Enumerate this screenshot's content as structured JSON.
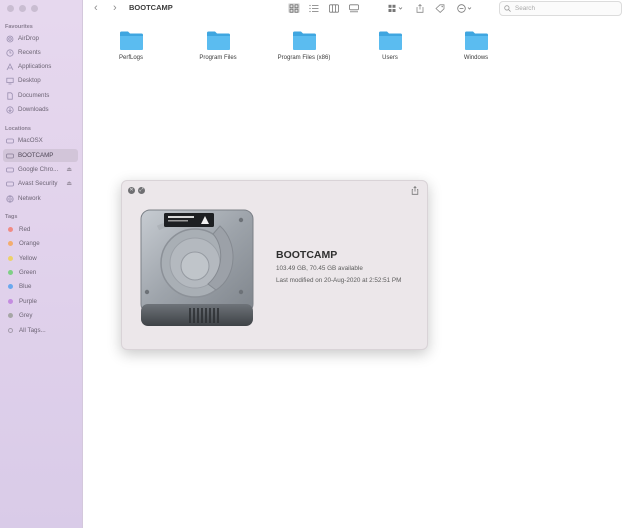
{
  "sidebar": {
    "favourites_title": "Favourites",
    "favourites": [
      {
        "label": "AirDrop",
        "icon": "airdrop-icon"
      },
      {
        "label": "Recents",
        "icon": "clock-icon"
      },
      {
        "label": "Applications",
        "icon": "applications-icon"
      },
      {
        "label": "Desktop",
        "icon": "desktop-icon"
      },
      {
        "label": "Documents",
        "icon": "document-icon"
      },
      {
        "label": "Downloads",
        "icon": "download-icon"
      }
    ],
    "locations_title": "Locations",
    "locations": [
      {
        "label": "MacOSX",
        "icon": "disk-icon"
      },
      {
        "label": "BOOTCAMP",
        "icon": "disk-icon"
      },
      {
        "label": "Google Chro...",
        "icon": "disk-icon"
      },
      {
        "label": "Avast Security",
        "icon": "disk-icon"
      },
      {
        "label": "Network",
        "icon": "network-icon"
      }
    ],
    "tags_title": "Tags",
    "tags": [
      {
        "label": "Red",
        "color": "#f08b84"
      },
      {
        "label": "Orange",
        "color": "#f3ad6e"
      },
      {
        "label": "Yellow",
        "color": "#ecd16a"
      },
      {
        "label": "Green",
        "color": "#7fcf86"
      },
      {
        "label": "Blue",
        "color": "#6aa8ee"
      },
      {
        "label": "Purple",
        "color": "#c48ce0"
      },
      {
        "label": "Grey",
        "color": "#a6a6a6"
      },
      {
        "label": "All Tags...",
        "color": ""
      }
    ]
  },
  "toolbar": {
    "title": "BOOTCAMP",
    "search_placeholder": "Search"
  },
  "files": [
    {
      "label": "PerfLogs"
    },
    {
      "label": "Program Files"
    },
    {
      "label": "Program Files (x86)"
    },
    {
      "label": "Users"
    },
    {
      "label": "Windows"
    }
  ],
  "info_window": {
    "volume_name": "BOOTCAMP",
    "capacity": "103.49 GB, 70.45 GB available",
    "modified": "Last modified on 20-Aug-2020 at 2:52:51 PM"
  },
  "colors": {
    "folder": "#5bbcf0",
    "sidebar_bg": "#e2d3ec",
    "accent": "#3d3d3d"
  }
}
